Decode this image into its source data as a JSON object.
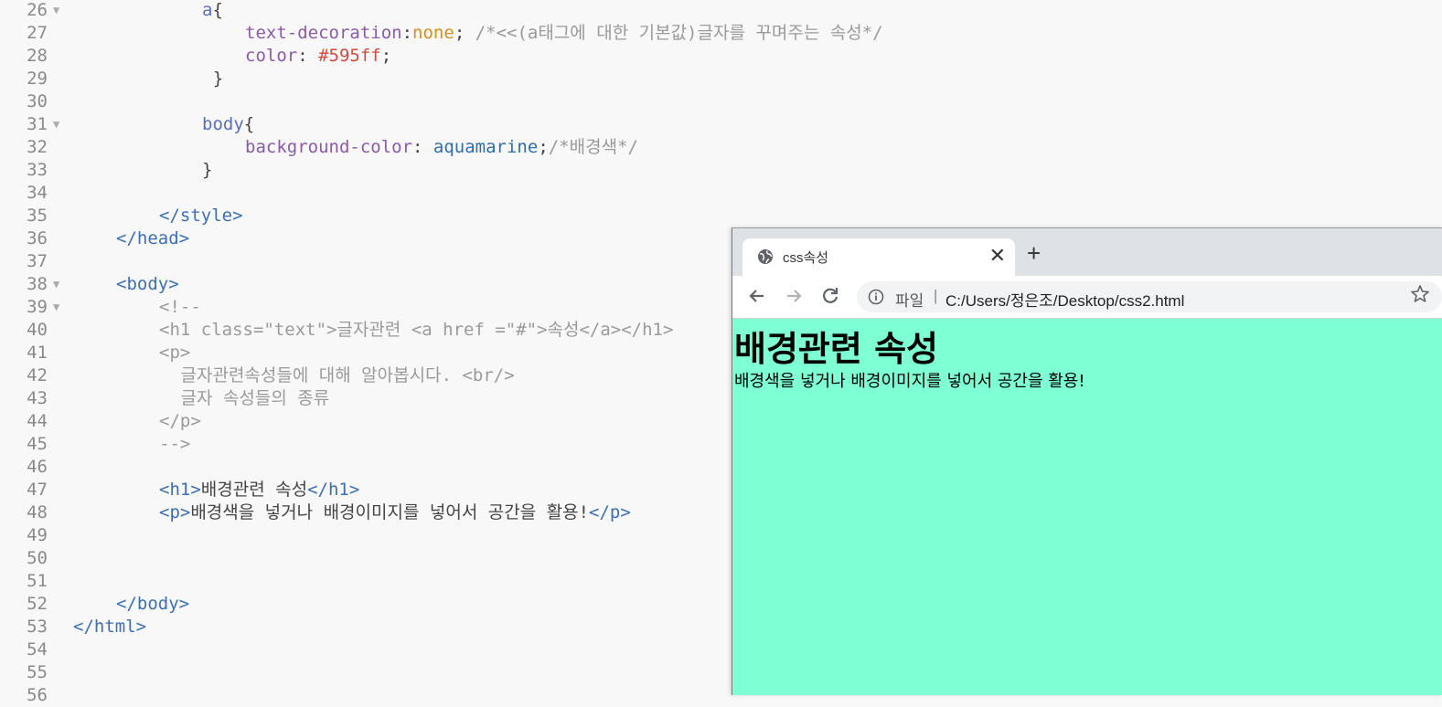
{
  "editor": {
    "lines": [
      {
        "n": "26",
        "fold": true,
        "indent": 12,
        "tokens": [
          {
            "c": "sel",
            "t": "a"
          },
          {
            "c": "pun",
            "t": "{"
          }
        ]
      },
      {
        "n": "27",
        "fold": false,
        "indent": 16,
        "tokens": [
          {
            "c": "prop",
            "t": "text-decoration"
          },
          {
            "c": "pun",
            "t": ":"
          },
          {
            "c": "kw",
            "t": "none"
          },
          {
            "c": "pun",
            "t": "; "
          },
          {
            "c": "cm",
            "t": "/*<<(a태그에 대한 기본값)글자를 꾸며주는 속성*/"
          }
        ]
      },
      {
        "n": "28",
        "fold": false,
        "indent": 16,
        "tokens": [
          {
            "c": "prop",
            "t": "color"
          },
          {
            "c": "pun",
            "t": ": "
          },
          {
            "c": "hex",
            "t": "#595ff"
          },
          {
            "c": "pun",
            "t": ";"
          }
        ]
      },
      {
        "n": "29",
        "fold": false,
        "indent": 13,
        "tokens": [
          {
            "c": "pun",
            "t": "}"
          }
        ]
      },
      {
        "n": "30",
        "fold": false,
        "indent": 0,
        "tokens": []
      },
      {
        "n": "31",
        "fold": true,
        "indent": 12,
        "tokens": [
          {
            "c": "sel",
            "t": "body"
          },
          {
            "c": "pun",
            "t": "{"
          }
        ]
      },
      {
        "n": "32",
        "fold": false,
        "indent": 16,
        "tokens": [
          {
            "c": "prop",
            "t": "background-color"
          },
          {
            "c": "pun",
            "t": ": "
          },
          {
            "c": "val",
            "t": "aquamarine"
          },
          {
            "c": "pun",
            "t": ";"
          },
          {
            "c": "cm",
            "t": "/*배경색*/"
          }
        ]
      },
      {
        "n": "33",
        "fold": false,
        "indent": 12,
        "tokens": [
          {
            "c": "pun",
            "t": "}"
          }
        ]
      },
      {
        "n": "34",
        "fold": false,
        "indent": 0,
        "tokens": []
      },
      {
        "n": "35",
        "fold": false,
        "indent": 8,
        "tokens": [
          {
            "c": "tag",
            "t": "</style>"
          }
        ]
      },
      {
        "n": "36",
        "fold": false,
        "indent": 4,
        "tokens": [
          {
            "c": "tag",
            "t": "</head>"
          }
        ]
      },
      {
        "n": "37",
        "fold": false,
        "indent": 0,
        "tokens": []
      },
      {
        "n": "38",
        "fold": true,
        "indent": 4,
        "tokens": [
          {
            "c": "tag",
            "t": "<body>"
          }
        ]
      },
      {
        "n": "39",
        "fold": true,
        "indent": 8,
        "tokens": [
          {
            "c": "cm",
            "t": "<!--"
          }
        ]
      },
      {
        "n": "40",
        "fold": false,
        "indent": 8,
        "tokens": [
          {
            "c": "cm",
            "t": "<h1 class=\"text\">글자관련 <a href =\"#\">속성</a></h1>"
          }
        ]
      },
      {
        "n": "41",
        "fold": false,
        "indent": 8,
        "tokens": [
          {
            "c": "cm",
            "t": "<p>"
          }
        ]
      },
      {
        "n": "42",
        "fold": false,
        "indent": 10,
        "tokens": [
          {
            "c": "cm",
            "t": "글자관련속성들에 대해 알아봅시다. <br/>"
          }
        ]
      },
      {
        "n": "43",
        "fold": false,
        "indent": 10,
        "tokens": [
          {
            "c": "cm",
            "t": "글자 속성들의 종류"
          }
        ]
      },
      {
        "n": "44",
        "fold": false,
        "indent": 8,
        "tokens": [
          {
            "c": "cm",
            "t": "</p>"
          }
        ]
      },
      {
        "n": "45",
        "fold": false,
        "indent": 8,
        "tokens": [
          {
            "c": "cm",
            "t": "-->"
          }
        ]
      },
      {
        "n": "46",
        "fold": false,
        "indent": 0,
        "tokens": []
      },
      {
        "n": "47",
        "fold": false,
        "indent": 8,
        "tokens": [
          {
            "c": "tag",
            "t": "<h1>"
          },
          {
            "c": "txt",
            "t": "배경관련 속성"
          },
          {
            "c": "tag",
            "t": "</h1>"
          }
        ]
      },
      {
        "n": "48",
        "fold": false,
        "indent": 8,
        "tokens": [
          {
            "c": "tag",
            "t": "<p>"
          },
          {
            "c": "txt",
            "t": "배경색을 넣거나 배경이미지를 넣어서 공간을 활용!"
          },
          {
            "c": "tag",
            "t": "</p>"
          }
        ]
      },
      {
        "n": "49",
        "fold": false,
        "indent": 0,
        "tokens": []
      },
      {
        "n": "50",
        "fold": false,
        "indent": 0,
        "tokens": []
      },
      {
        "n": "51",
        "fold": false,
        "indent": 0,
        "tokens": []
      },
      {
        "n": "52",
        "fold": false,
        "indent": 4,
        "tokens": [
          {
            "c": "tag",
            "t": "</body>"
          }
        ]
      },
      {
        "n": "53",
        "fold": false,
        "indent": 0,
        "tokens": [
          {
            "c": "tag",
            "t": "</html>"
          }
        ]
      },
      {
        "n": "54",
        "fold": false,
        "indent": 0,
        "tokens": []
      },
      {
        "n": "55",
        "fold": false,
        "indent": 0,
        "tokens": []
      },
      {
        "n": "56",
        "fold": false,
        "indent": 0,
        "tokens": []
      }
    ]
  },
  "browser": {
    "tab_title": "css속성",
    "tab_icon": "globe-icon",
    "address": {
      "label": "파일",
      "separator": "|",
      "url": "C:/Users/정은조/Desktop/css2.html"
    },
    "page": {
      "background": "#7fffd4",
      "heading": "배경관련 속성",
      "paragraph": "배경색을 넣거나 배경이미지를 넣어서 공간을 활용!"
    }
  }
}
